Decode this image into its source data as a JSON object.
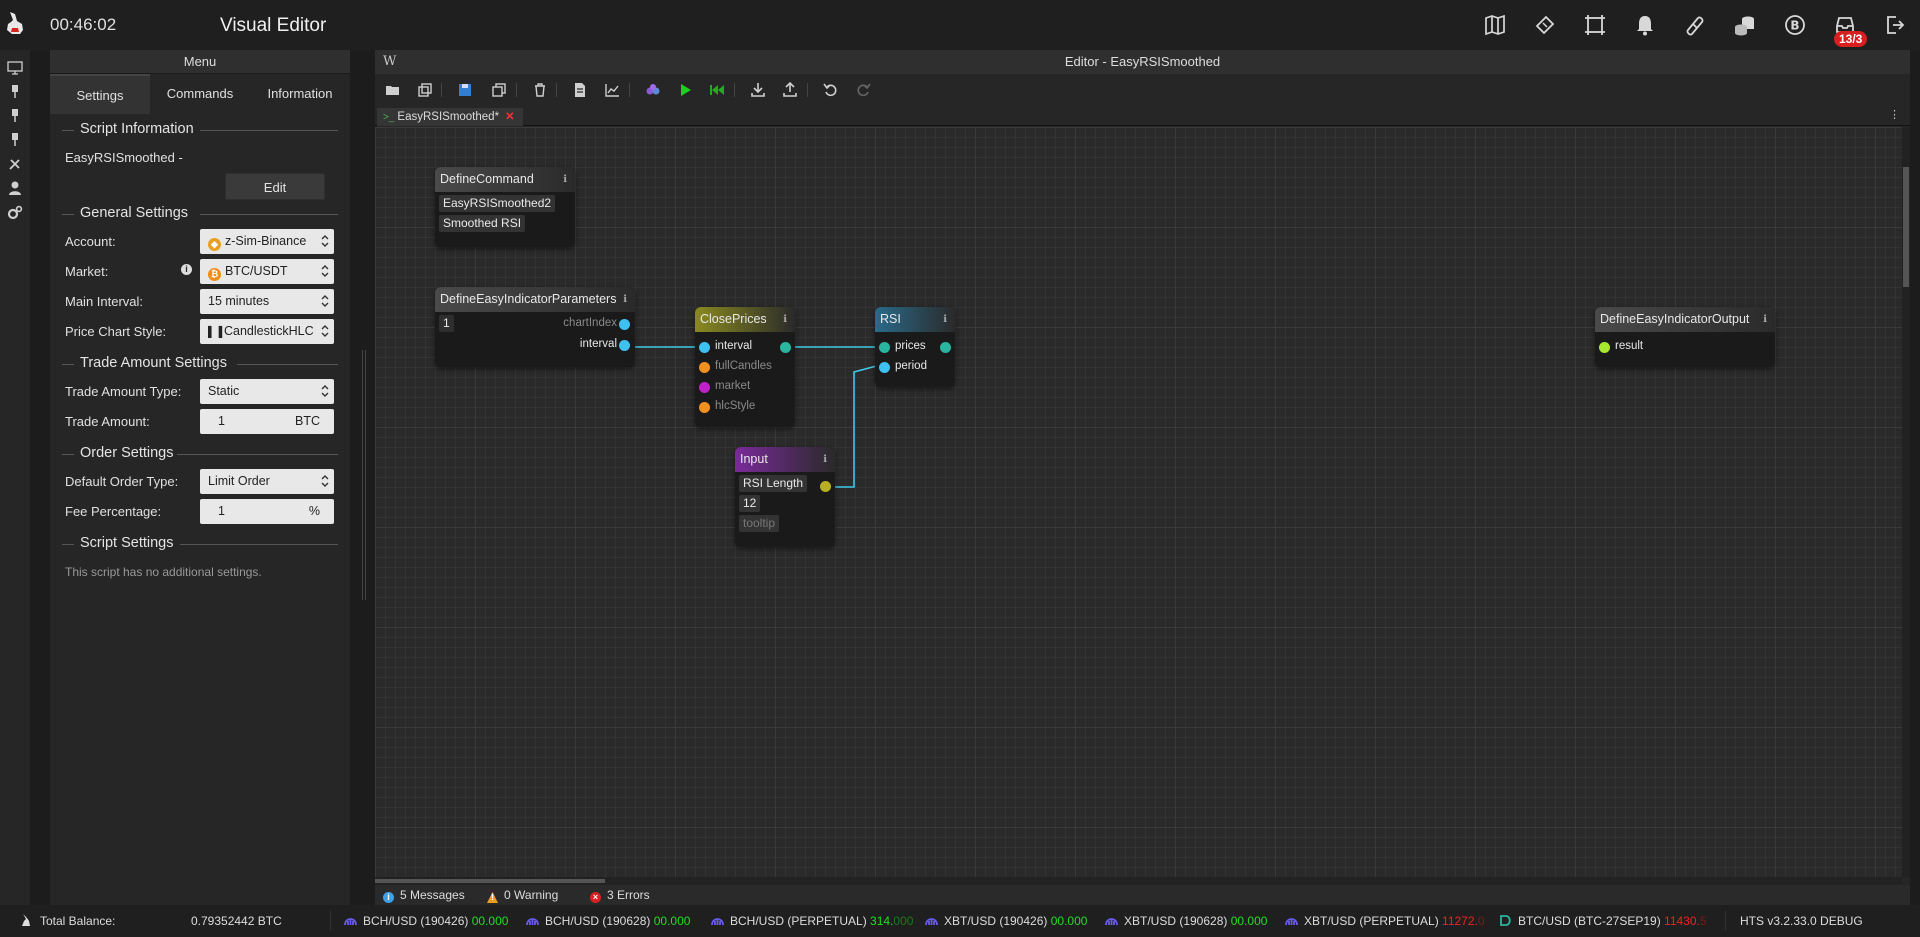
{
  "top": {
    "timer": "00:46:02",
    "title": "Visual Editor",
    "badge": "13/3"
  },
  "menu": {
    "header": "Menu",
    "tabs": [
      "Settings",
      "Commands",
      "Information"
    ],
    "script_info": {
      "title": "Script Information",
      "name": "EasyRSISmoothed -",
      "edit_label": "Edit"
    },
    "general": {
      "title": "General Settings",
      "account_label": "Account:",
      "account_value": "z-Sim-Binance",
      "market_label": "Market:",
      "market_value": "BTC/USDT",
      "interval_label": "Main Interval:",
      "interval_value": "15 minutes",
      "chart_style_label": "Price Chart Style:",
      "chart_style_value": "CandlestickHLC"
    },
    "trade": {
      "title": "Trade Amount Settings",
      "type_label": "Trade Amount Type:",
      "type_value": "Static",
      "amount_label": "Trade Amount:",
      "amount_value": "1",
      "amount_unit": "BTC"
    },
    "order": {
      "title": "Order Settings",
      "type_label": "Default Order Type:",
      "type_value": "Limit Order",
      "fee_label": "Fee Percentage:",
      "fee_value": "1",
      "fee_unit": "%"
    },
    "script_settings": {
      "title": "Script Settings",
      "note": "This script has no additional settings."
    }
  },
  "editor": {
    "w": "W",
    "title": "Editor - EasyRSISmoothed",
    "file_tab": "EasyRSISmoothed*",
    "term": ">_",
    "nodes": {
      "define_command": {
        "title": "DefineCommand",
        "f1": "EasyRSISmoothed2",
        "f2": "Smoothed RSI"
      },
      "params": {
        "title": "DefineEasyIndicatorParameters",
        "field": "1",
        "p1": "chartIndex",
        "p2": "interval"
      },
      "close": {
        "title": "ClosePrices",
        "p1": "interval",
        "p2": "fullCandles",
        "p3": "market",
        "p4": "hlcStyle"
      },
      "rsi": {
        "title": "RSI",
        "p1": "prices",
        "p2": "period"
      },
      "input": {
        "title": "Input",
        "f1": "RSI Length",
        "f2": "12",
        "f3": "tooltip"
      },
      "output": {
        "title": "DefineEasyIndicatorOutput",
        "p1": "result"
      }
    },
    "status": {
      "messages": "5 Messages",
      "warnings": "0 Warning",
      "errors": "3 Errors"
    }
  },
  "bottom": {
    "balance_label": "Total Balance:",
    "balance_value": "0.79352442 BTC",
    "tickers": [
      {
        "pair": "BCH/USD (190426)",
        "price": "00.000"
      },
      {
        "pair": "BCH/USD (190628)",
        "price": "00.000"
      },
      {
        "pair": "BCH/USD (PERPETUAL)",
        "price": "314.",
        "price_dim": "000"
      },
      {
        "pair": "XBT/USD (190426)",
        "price": "00.000"
      },
      {
        "pair": "XBT/USD (190628)",
        "price": "00.000"
      },
      {
        "pair": "XBT/USD (PERPETUAL)",
        "price": "11272.",
        "price_dim": "0"
      },
      {
        "pair": "BTC/USD (BTC-27SEP19)",
        "price": "11430.",
        "price_dim": "5"
      }
    ],
    "version": "HTS v3.2.33.0 DEBUG"
  },
  "colors": {
    "accent_blue": "#3fc1f0",
    "link_cyan": "#3fc9e8",
    "status_green": "#22dd22",
    "status_red": "#ee2222"
  }
}
